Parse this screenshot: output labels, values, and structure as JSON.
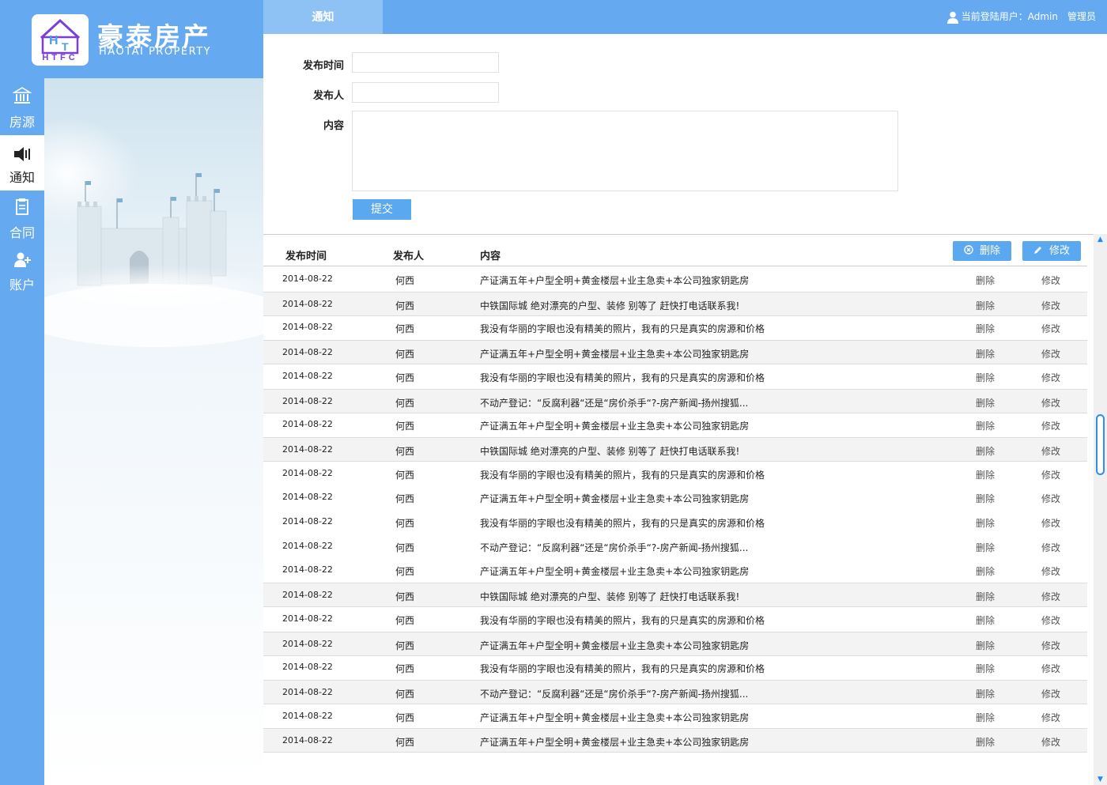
{
  "brand": {
    "logo_letters": "HTFC",
    "logo_mark": "HT",
    "name_cn": "豪泰房产",
    "name_en": "HAOTAI PROPERTY"
  },
  "side_nav": [
    {
      "label": "房源",
      "icon": "building-icon",
      "active": false
    },
    {
      "label": "通知",
      "icon": "speaker-icon",
      "active": true
    },
    {
      "label": "合同",
      "icon": "document-icon",
      "active": false
    },
    {
      "label": "账户",
      "icon": "user-add-icon",
      "active": false
    }
  ],
  "header": {
    "active_tab": "通知",
    "user_prefix": "当前登陆用户：Admin",
    "role": "管理员"
  },
  "form": {
    "time_label": "发布时间",
    "time_value": "",
    "publisher_label": "发布人",
    "publisher_value": "",
    "content_label": "内容",
    "content_value": "",
    "submit_label": "提交"
  },
  "table": {
    "columns": [
      "发布时间",
      "发布人",
      "内容"
    ],
    "delete_all_label": "删除",
    "edit_label": "修改",
    "action_delete": "删除",
    "action_edit": "修改",
    "rows": [
      {
        "date": "2014-08-22",
        "publisher": "何西",
        "content": "产证满五年+户型全明+黄金楼层+业主急卖+本公司独家钥匙房"
      },
      {
        "date": "2014-08-22",
        "publisher": "何西",
        "content": "中铁国际城 绝对漂亮的户型、装修 别等了 赶快打电话联系我!"
      },
      {
        "date": "2014-08-22",
        "publisher": "何西",
        "content": "我没有华丽的字眼也没有精美的照片，我有的只是真实的房源和价格"
      },
      {
        "date": "2014-08-22",
        "publisher": "何西",
        "content": "产证满五年+户型全明+黄金楼层+业主急卖+本公司独家钥匙房"
      },
      {
        "date": "2014-08-22",
        "publisher": "何西",
        "content": "我没有华丽的字眼也没有精美的照片，我有的只是真实的房源和价格"
      },
      {
        "date": "2014-08-22",
        "publisher": "何西",
        "content": "不动产登记：“反腐利器“还是“房价杀手“?-房产新闻-扬州搜狐..."
      },
      {
        "date": "2014-08-22",
        "publisher": "何西",
        "content": "产证满五年+户型全明+黄金楼层+业主急卖+本公司独家钥匙房"
      },
      {
        "date": "2014-08-22",
        "publisher": "何西",
        "content": "中铁国际城 绝对漂亮的户型、装修 别等了 赶快打电话联系我!"
      },
      {
        "date": "2014-08-22",
        "publisher": "何西",
        "content": "我没有华丽的字眼也没有精美的照片，我有的只是真实的房源和价格"
      },
      {
        "date": "2014-08-22",
        "publisher": "何西",
        "content": "产证满五年+户型全明+黄金楼层+业主急卖+本公司独家钥匙房"
      },
      {
        "date": "2014-08-22",
        "publisher": "何西",
        "content": "我没有华丽的字眼也没有精美的照片，我有的只是真实的房源和价格"
      },
      {
        "date": "2014-08-22",
        "publisher": "何西",
        "content": "不动产登记：“反腐利器“还是“房价杀手“?-房产新闻-扬州搜狐..."
      },
      {
        "date": "2014-08-22",
        "publisher": "何西",
        "content": "产证满五年+户型全明+黄金楼层+业主急卖+本公司独家钥匙房"
      },
      {
        "date": "2014-08-22",
        "publisher": "何西",
        "content": "中铁国际城 绝对漂亮的户型、装修 别等了 赶快打电话联系我!"
      },
      {
        "date": "2014-08-22",
        "publisher": "何西",
        "content": "我没有华丽的字眼也没有精美的照片，我有的只是真实的房源和价格"
      },
      {
        "date": "2014-08-22",
        "publisher": "何西",
        "content": "产证满五年+户型全明+黄金楼层+业主急卖+本公司独家钥匙房"
      },
      {
        "date": "2014-08-22",
        "publisher": "何西",
        "content": "我没有华丽的字眼也没有精美的照片，我有的只是真实的房源和价格"
      },
      {
        "date": "2014-08-22",
        "publisher": "何西",
        "content": "不动产登记：“反腐利器“还是“房价杀手“?-房产新闻-扬州搜狐..."
      },
      {
        "date": "2014-08-22",
        "publisher": "何西",
        "content": "产证满五年+户型全明+黄金楼层+业主急卖+本公司独家钥匙房"
      },
      {
        "date": "2014-08-22",
        "publisher": "何西",
        "content": "产证满五年+户型全明+黄金楼层+业主急卖+本公司独家钥匙房"
      }
    ]
  },
  "colors": {
    "primary": "#65aaf0",
    "button": "#5aa8ef",
    "tab_active": "#8fc2f4",
    "row_alt": "#f3f3f3",
    "logo_purple": "#7b3fd6"
  }
}
